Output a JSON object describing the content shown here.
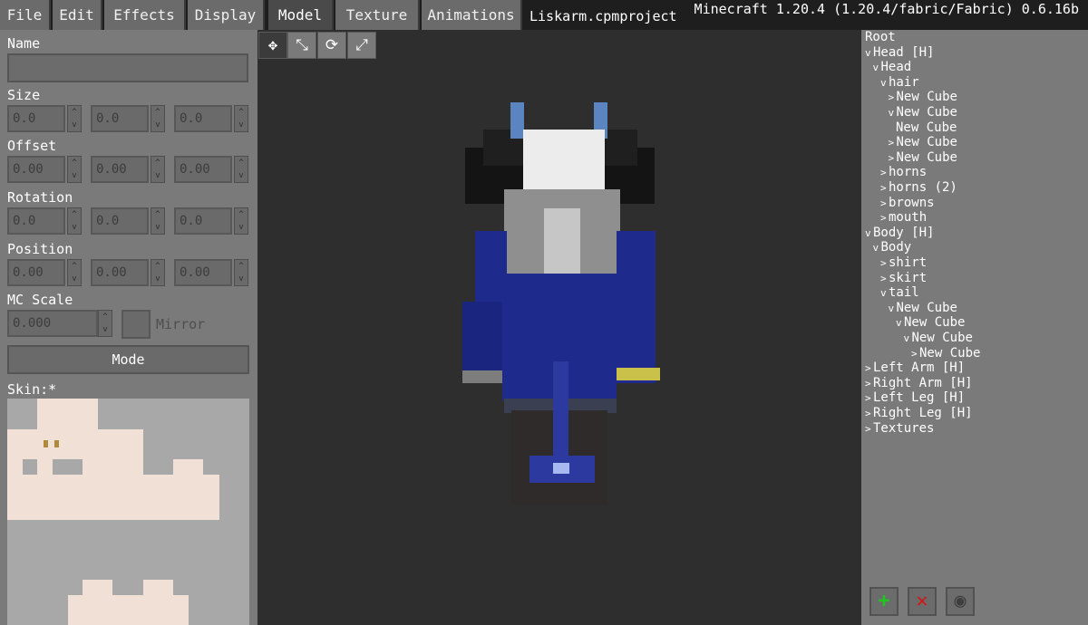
{
  "menu": {
    "items": [
      "File",
      "Edit",
      "Effects",
      "Display",
      "Model",
      "Texture",
      "Animations"
    ],
    "active": "Model"
  },
  "project_title": "Liskarm.cpmproject",
  "version_text": "Minecraft 1.20.4 (1.20.4/fabric/Fabric) 0.6.16b",
  "properties": {
    "name_label": "Name",
    "name_value": "",
    "size_label": "Size",
    "size": [
      "0.0",
      "0.0",
      "0.0"
    ],
    "offset_label": "Offset",
    "offset": [
      "0.00",
      "0.00",
      "0.00"
    ],
    "rotation_label": "Rotation",
    "rotation": [
      "0.0",
      "0.0",
      "0.0"
    ],
    "position_label": "Position",
    "position": [
      "0.00",
      "0.00",
      "0.00"
    ],
    "mc_scale_label": "MC Scale",
    "mc_scale": "0.000",
    "mirror_label": "Mirror",
    "mode_label": "Mode",
    "skin_label": "Skin:*"
  },
  "spinner": {
    "up": "^",
    "down": "v"
  },
  "tools": [
    {
      "icon": "move-icon",
      "glyph": "✥"
    },
    {
      "icon": "resize-icon",
      "glyph": "⤡"
    },
    {
      "icon": "rotate-icon",
      "glyph": "⟳"
    },
    {
      "icon": "scale-icon",
      "glyph": "⤢"
    }
  ],
  "tree": [
    {
      "label": "Root",
      "depth": 0,
      "arrow": ""
    },
    {
      "label": "Head [H]",
      "depth": 0,
      "arrow": "v"
    },
    {
      "label": "Head",
      "depth": 1,
      "arrow": "v"
    },
    {
      "label": "hair",
      "depth": 2,
      "arrow": "v"
    },
    {
      "label": "New Cube",
      "depth": 3,
      "arrow": ">"
    },
    {
      "label": "New Cube",
      "depth": 3,
      "arrow": "v"
    },
    {
      "label": "New Cube",
      "depth": 4,
      "arrow": ""
    },
    {
      "label": "New Cube",
      "depth": 3,
      "arrow": ">"
    },
    {
      "label": "New Cube",
      "depth": 3,
      "arrow": ">"
    },
    {
      "label": "horns",
      "depth": 2,
      "arrow": ">"
    },
    {
      "label": "horns (2)",
      "depth": 2,
      "arrow": ">"
    },
    {
      "label": "browns",
      "depth": 2,
      "arrow": ">"
    },
    {
      "label": "mouth",
      "depth": 2,
      "arrow": ">"
    },
    {
      "label": "Body [H]",
      "depth": 0,
      "arrow": "v"
    },
    {
      "label": "Body",
      "depth": 1,
      "arrow": "v"
    },
    {
      "label": "shirt",
      "depth": 2,
      "arrow": ">"
    },
    {
      "label": "skirt",
      "depth": 2,
      "arrow": ">"
    },
    {
      "label": "tail",
      "depth": 2,
      "arrow": "v"
    },
    {
      "label": "New Cube",
      "depth": 3,
      "arrow": "v"
    },
    {
      "label": "New Cube",
      "depth": 4,
      "arrow": "v"
    },
    {
      "label": "New Cube",
      "depth": 5,
      "arrow": "v"
    },
    {
      "label": "New Cube",
      "depth": 6,
      "arrow": ">"
    },
    {
      "label": "Left Arm [H]",
      "depth": 0,
      "arrow": ">"
    },
    {
      "label": "Right Arm [H]",
      "depth": 0,
      "arrow": ">"
    },
    {
      "label": "Left Leg [H]",
      "depth": 0,
      "arrow": ">"
    },
    {
      "label": "Right Leg [H]",
      "depth": 0,
      "arrow": ">"
    },
    {
      "label": "Textures",
      "depth": 0,
      "arrow": ">"
    }
  ],
  "actions": [
    {
      "icon": "add-icon",
      "glyph": "+",
      "color": "#22c422"
    },
    {
      "icon": "delete-icon",
      "glyph": "✕",
      "color": "#d01818"
    },
    {
      "icon": "visibility-icon",
      "glyph": "◉",
      "color": "#3e3e3e"
    }
  ]
}
